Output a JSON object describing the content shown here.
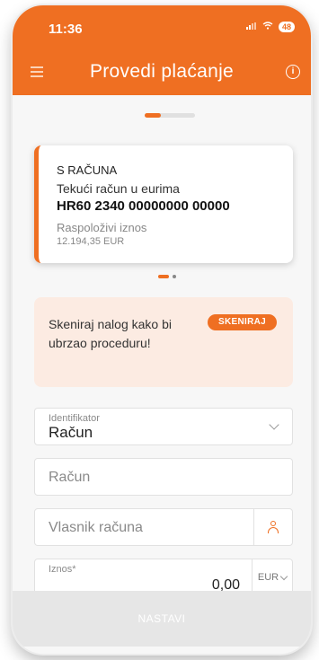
{
  "status_bar": {
    "time": "11:36",
    "battery": "48"
  },
  "header": {
    "title": "Provedi plaćanje"
  },
  "account": {
    "label": "S RAČUNA",
    "type": "Tekući račun u eurima",
    "iban": "HR60 2340 00000000 00000",
    "available_label": "Raspoloživi iznos",
    "available_value": "12.194,35 EUR"
  },
  "scan": {
    "text": "Skeniraj nalog kako bi ubrzao proceduru!",
    "button": "SKENIRAJ"
  },
  "form": {
    "identifier_label": "Identifikator",
    "identifier_value": "Račun",
    "account_placeholder": "Račun",
    "owner_placeholder": "Vlasnik računa",
    "amount_label": "Iznos*",
    "amount_value": "0,00",
    "currency": "EUR"
  },
  "footer": {
    "continue": "NASTAVI"
  },
  "colors": {
    "accent": "#ef6f22",
    "scan_bg": "#fcebe2",
    "disabled": "#e6e6e6"
  },
  "icons": [
    "menu-icon",
    "info-icon",
    "chevron-down-icon",
    "person-icon",
    "wifi-icon",
    "signal-icon"
  ],
  "carousel": {
    "pages": 2,
    "active": 1
  },
  "steps": {
    "current": 1,
    "total": 3
  }
}
